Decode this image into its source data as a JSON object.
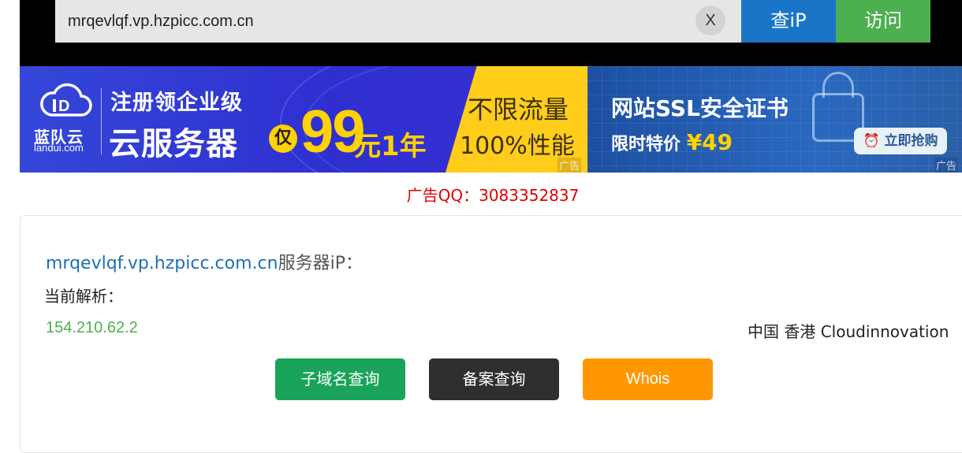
{
  "search": {
    "value": "mrqevlqf.vp.hzpicc.com.cn",
    "clear_label": "X",
    "query_ip_label": "查iP",
    "visit_label": "访问"
  },
  "banner": {
    "ad1": {
      "brand": "蓝队云",
      "brand_domain": "landui.com",
      "line1": "注册领企业级",
      "line2": "云服务器",
      "only": "仅",
      "price": "99",
      "price_unit": "元1年",
      "side_line1": "不限流量",
      "side_line2": "100%性能",
      "tag": "广告"
    },
    "ad2": {
      "title": "网站SSL安全证书",
      "sub_label": "限时特价",
      "price": "¥49",
      "button": "立即抢购",
      "tag": "广告"
    }
  },
  "ad_contact": "广告QQ：3083352837",
  "result": {
    "domain": "mrqevlqf.vp.hzpicc.com.cn",
    "domain_suffix": "服务器iP：",
    "resolve_label": "当前解析：",
    "ip": "154.210.62.2",
    "location": "中国 香港 Cloudinnovation"
  },
  "actions": {
    "subdomain": "子域名查询",
    "beian": "备案查询",
    "whois": "Whois"
  },
  "colors": {
    "accent_blue": "#1a75c9",
    "accent_green": "#4caf50",
    "ip_green": "#4caf50",
    "alert_red": "#e00000",
    "whois_orange": "#ff9800"
  }
}
